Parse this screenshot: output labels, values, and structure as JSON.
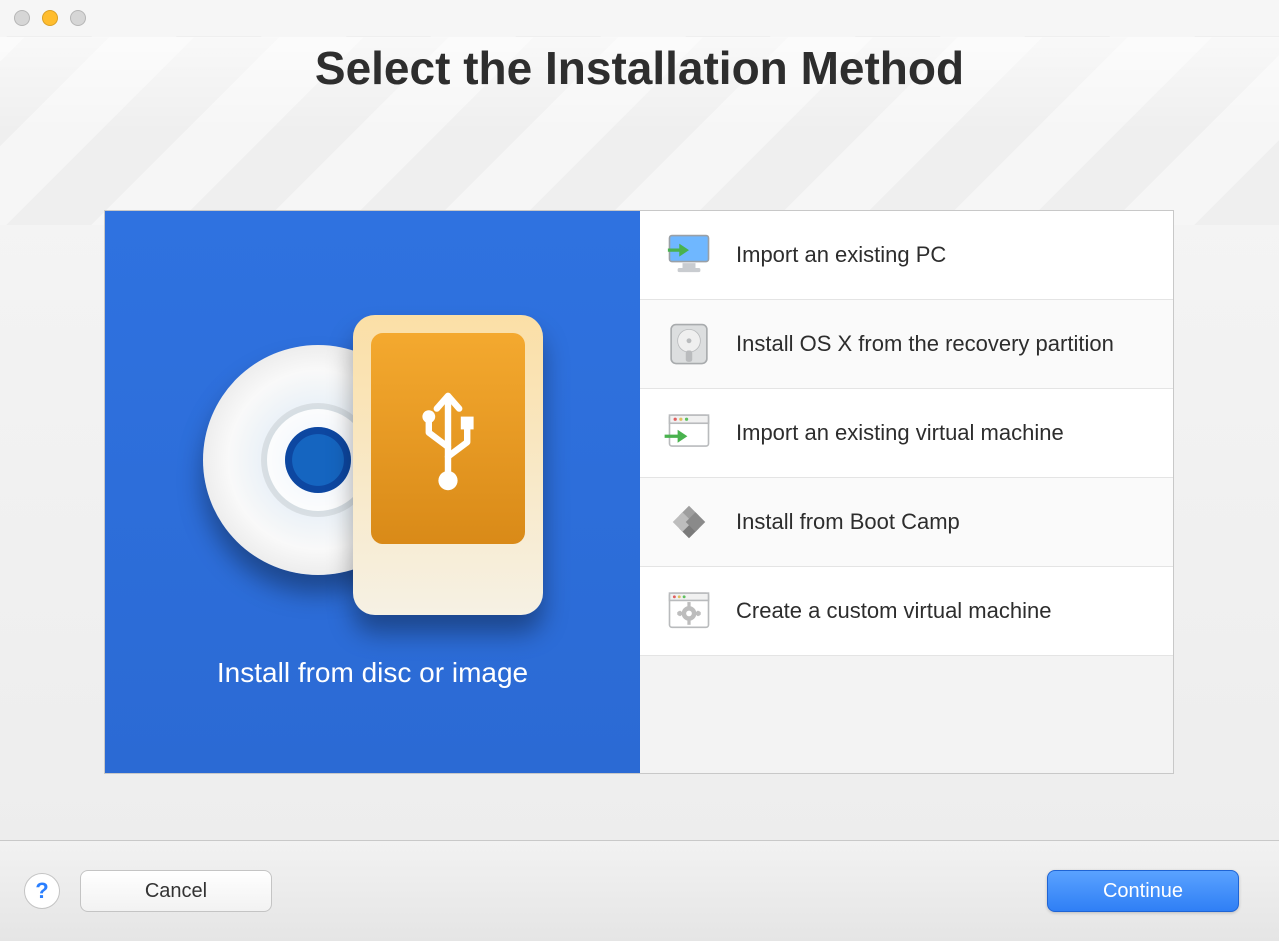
{
  "window": {
    "title": "Select the Installation Method"
  },
  "feature": {
    "label": "Install from disc or image",
    "icon": "disc-and-usb-drive-icon"
  },
  "options": [
    {
      "label": "Import an existing PC",
      "icon": "monitor-import-icon"
    },
    {
      "label": "Install OS X from the recovery partition",
      "icon": "hard-disk-icon"
    },
    {
      "label": "Import an existing virtual machine",
      "icon": "window-import-icon"
    },
    {
      "label": "Install from Boot Camp",
      "icon": "bootcamp-diamonds-icon"
    },
    {
      "label": "Create a custom virtual machine",
      "icon": "gear-window-icon"
    }
  ],
  "footer": {
    "help": "?",
    "cancel": "Cancel",
    "continue": "Continue"
  }
}
